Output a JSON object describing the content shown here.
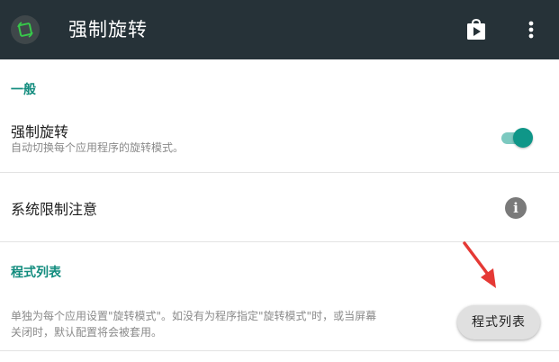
{
  "app_bar": {
    "title": "强制旋转",
    "icons": {
      "app": "rotate-app-icon",
      "store": "play-store-icon",
      "more": "more-vert-icon"
    }
  },
  "general": {
    "header": "一般",
    "force_rotation": {
      "title": "强制旋转",
      "summary": "自动切换每个应用程序的旋转模式。",
      "enabled": true
    },
    "system_limits": {
      "title": "系统限制注意"
    }
  },
  "app_list_section": {
    "header": "程式列表",
    "summary_line1": "单独为每个应用设置\"旋转模式\"。如没有为程序指定\"旋转模式\"时，或当屏幕",
    "summary_line2": "关闭时，默认配置将会被套用。",
    "button_label": "程式列表"
  },
  "colors": {
    "app_bar": "#263238",
    "accent": "#128c7e",
    "annotation_arrow": "#e53935"
  }
}
